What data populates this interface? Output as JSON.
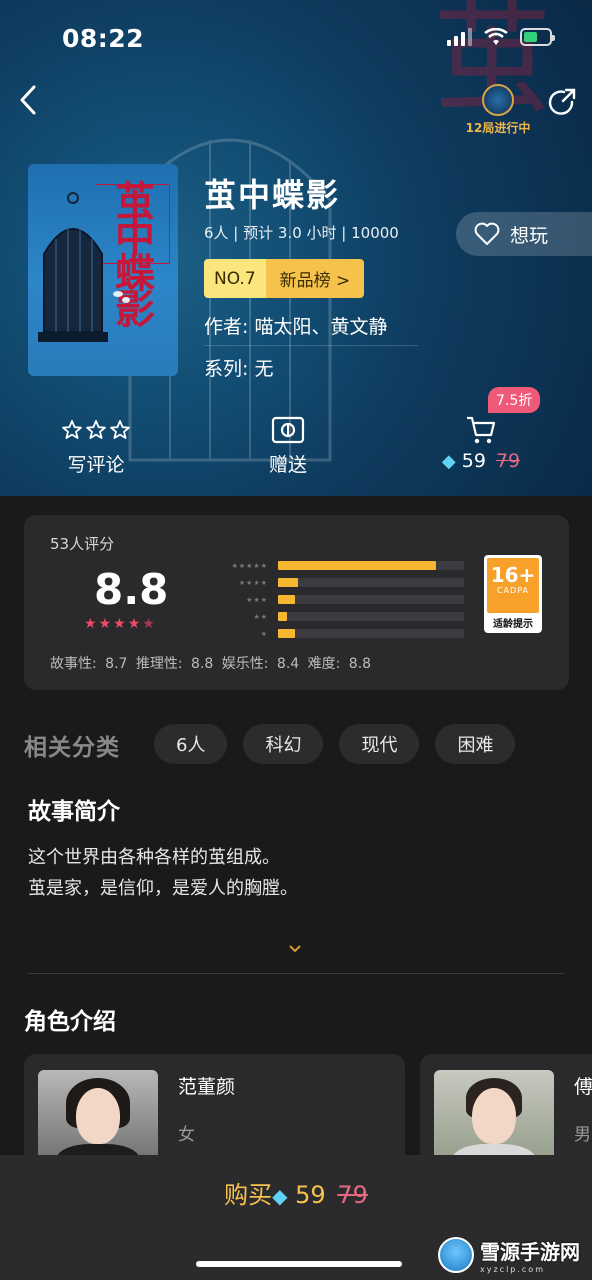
{
  "status": {
    "time": "08:22"
  },
  "header": {
    "live_text": "12局进行中"
  },
  "book": {
    "title": "茧中蝶影",
    "meta": "6人 | 预计 3.0 小时 | 10000",
    "rank_no": "NO.7",
    "rank_list": "新品榜 >",
    "author": "作者: 喵太阳、黄文静",
    "series": "系列: 无",
    "want_label": "想玩",
    "cover_title": "茧中蝶影"
  },
  "actions": {
    "review": "写评论",
    "gift": "赠送",
    "discount": "7.5折",
    "price": "59",
    "orig_price": "79"
  },
  "rating": {
    "label": "53人评分",
    "score": "8.8",
    "star_value": 4.5,
    "distribution": [
      0.85,
      0.11,
      0.09,
      0.05,
      0.09
    ],
    "sub_scores": "故事性: 8.7  推理性: 8.8  娱乐性: 8.4  难度: 8.8",
    "age": "16+",
    "age_org": "CADPA",
    "age_tip": "适龄提示"
  },
  "categories": {
    "title": "相关分类",
    "tags": [
      "6人",
      "科幻",
      "现代",
      "困难"
    ]
  },
  "story": {
    "title": "故事简介",
    "line1": "这个世界由各种各样的茧组成。",
    "line2": "茧是家，是信仰，是爱人的胸膛。"
  },
  "characters": {
    "title": "角色介绍",
    "items": [
      {
        "name": "范董颜",
        "gender": "女"
      },
      {
        "name": "傅",
        "gender": "男"
      }
    ]
  },
  "bottom": {
    "buy_label": "购买",
    "price": "59",
    "orig_price": "79"
  },
  "watermark": {
    "name": "雪源手游网",
    "url": "xyzclp.com"
  },
  "colors": {
    "accent": "#f7c24b",
    "discount": "#ef5a78",
    "hero": "#134f75"
  }
}
